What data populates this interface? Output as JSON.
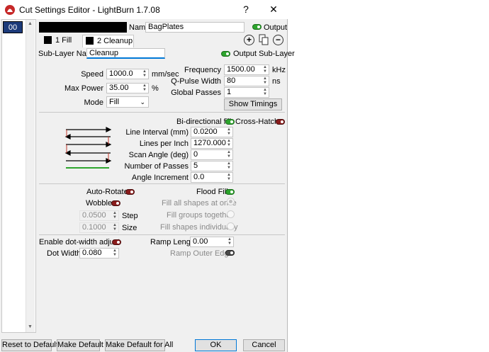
{
  "window": {
    "title": "Cut Settings Editor - LightBurn 1.7.08",
    "help_label": "?",
    "close_label": "✕"
  },
  "layers": {
    "selected": "00",
    "color": "#1c3a7a"
  },
  "name": {
    "label": "Name",
    "value": "BagPlates",
    "output_label": "Output"
  },
  "tabs": [
    {
      "label": "1 Fill"
    },
    {
      "label": "2 Cleanup"
    }
  ],
  "sublayer": {
    "label": "Sub-Layer Name",
    "value": "Cleanup",
    "output_label": "Output Sub-Layer"
  },
  "speed": {
    "label": "Speed",
    "value": "1000.0",
    "unit": "mm/sec"
  },
  "max_power": {
    "label": "Max Power",
    "value": "35.00",
    "unit": "%"
  },
  "mode": {
    "label": "Mode",
    "value": "Fill"
  },
  "frequency": {
    "label": "Frequency",
    "value": "1500.00",
    "unit": "kHz"
  },
  "qpulse": {
    "label": "Q-Pulse Width",
    "value": "80",
    "unit": "ns"
  },
  "global_passes": {
    "label": "Global Passes",
    "value": "1"
  },
  "show_timings_label": "Show Timings",
  "bidirectional_label": "Bi-directional fill",
  "crosshatch_label": "Cross-Hatch",
  "line_interval": {
    "label": "Line Interval (mm)",
    "value": "0.0200"
  },
  "lines_per_inch": {
    "label": "Lines per Inch",
    "value": "1270.000"
  },
  "scan_angle": {
    "label": "Scan Angle (deg)",
    "value": "0"
  },
  "num_passes": {
    "label": "Number of Passes",
    "value": "5"
  },
  "angle_increment": {
    "label": "Angle Increment",
    "value": "0.0"
  },
  "auto_rotate_label": "Auto-Rotate",
  "flood_fill_label": "Flood Fill",
  "wobble_label": "Wobble",
  "step": {
    "label": "Step",
    "value": "0.0500"
  },
  "size": {
    "label": "Size",
    "value": "0.1000"
  },
  "fill_all_label": "Fill all shapes at once",
  "fill_groups_label": "Fill groups together",
  "fill_individually_label": "Fill shapes individually",
  "dot_width_adjust_label": "Enable dot-width adjust",
  "dot_width": {
    "label": "Dot Width:",
    "value": "0.080"
  },
  "ramp_length": {
    "label": "Ramp Length",
    "value": "0.00"
  },
  "ramp_outer_label": "Ramp Outer Edge",
  "footer": {
    "reset": "Reset to Default",
    "make_default": "Make Default",
    "make_default_all": "Make Default for All",
    "ok": "OK",
    "cancel": "Cancel"
  },
  "colors": {
    "toggle_on": "#2da52d",
    "toggle_off": "#8b1c1c",
    "accent": "#0078d7"
  }
}
